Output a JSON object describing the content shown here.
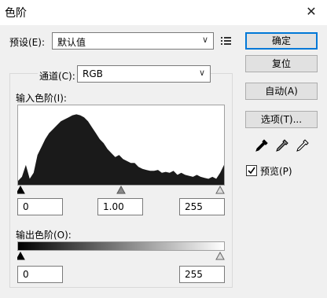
{
  "window": {
    "title": "色阶",
    "close_glyph": "✕"
  },
  "preset": {
    "label": "预设(E):",
    "value": "默认值",
    "options_icon": "preset-options-icon"
  },
  "channel": {
    "label": "通道(C):",
    "value": "RGB"
  },
  "input_levels": {
    "label": "输入色阶(I):",
    "black": "0",
    "gamma": "1.00",
    "white": "255",
    "histogram_y": [
      4,
      8,
      20,
      6,
      12,
      30,
      38,
      46,
      52,
      56,
      60,
      64,
      66,
      68,
      70,
      71,
      70,
      68,
      64,
      58,
      52,
      46,
      42,
      36,
      32,
      28,
      30,
      26,
      24,
      22,
      22,
      18,
      16,
      15,
      14,
      14,
      15,
      12,
      13,
      12,
      14,
      10,
      12,
      10,
      9,
      8,
      10,
      8,
      7,
      6,
      8,
      6,
      12,
      20
    ]
  },
  "output_levels": {
    "label": "输出色阶(O):",
    "black": "0",
    "white": "255"
  },
  "buttons": {
    "ok": "确定",
    "reset": "复位",
    "auto": "自动(A)",
    "options": "选项(T)..."
  },
  "preview": {
    "label": "预览(P)",
    "checked": true
  },
  "eyedroppers": [
    "black-eyedropper-icon",
    "gray-eyedropper-icon",
    "white-eyedropper-icon"
  ]
}
